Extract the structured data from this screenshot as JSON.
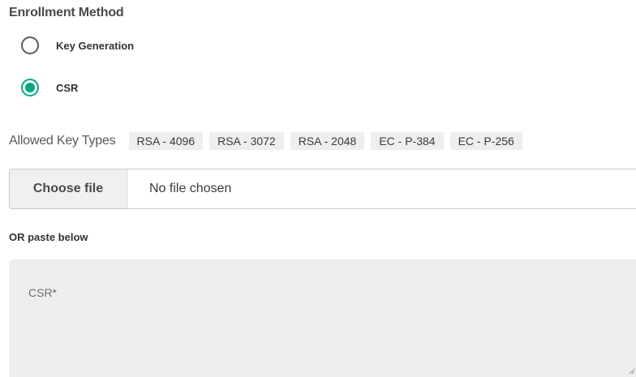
{
  "enrollment": {
    "title": "Enrollment Method",
    "options": [
      {
        "label": "Key Generation",
        "selected": false
      },
      {
        "label": "CSR",
        "selected": true
      }
    ]
  },
  "key_types": {
    "label": "Allowed Key Types",
    "chips": [
      "RSA - 4096",
      "RSA - 3072",
      "RSA - 2048",
      "EC - P-384",
      "EC - P-256"
    ]
  },
  "file_input": {
    "button_label": "Choose file",
    "status": "No file chosen"
  },
  "paste": {
    "label": "OR paste below",
    "csr_placeholder": "CSR*"
  },
  "colors": {
    "accent": "#01a982"
  }
}
